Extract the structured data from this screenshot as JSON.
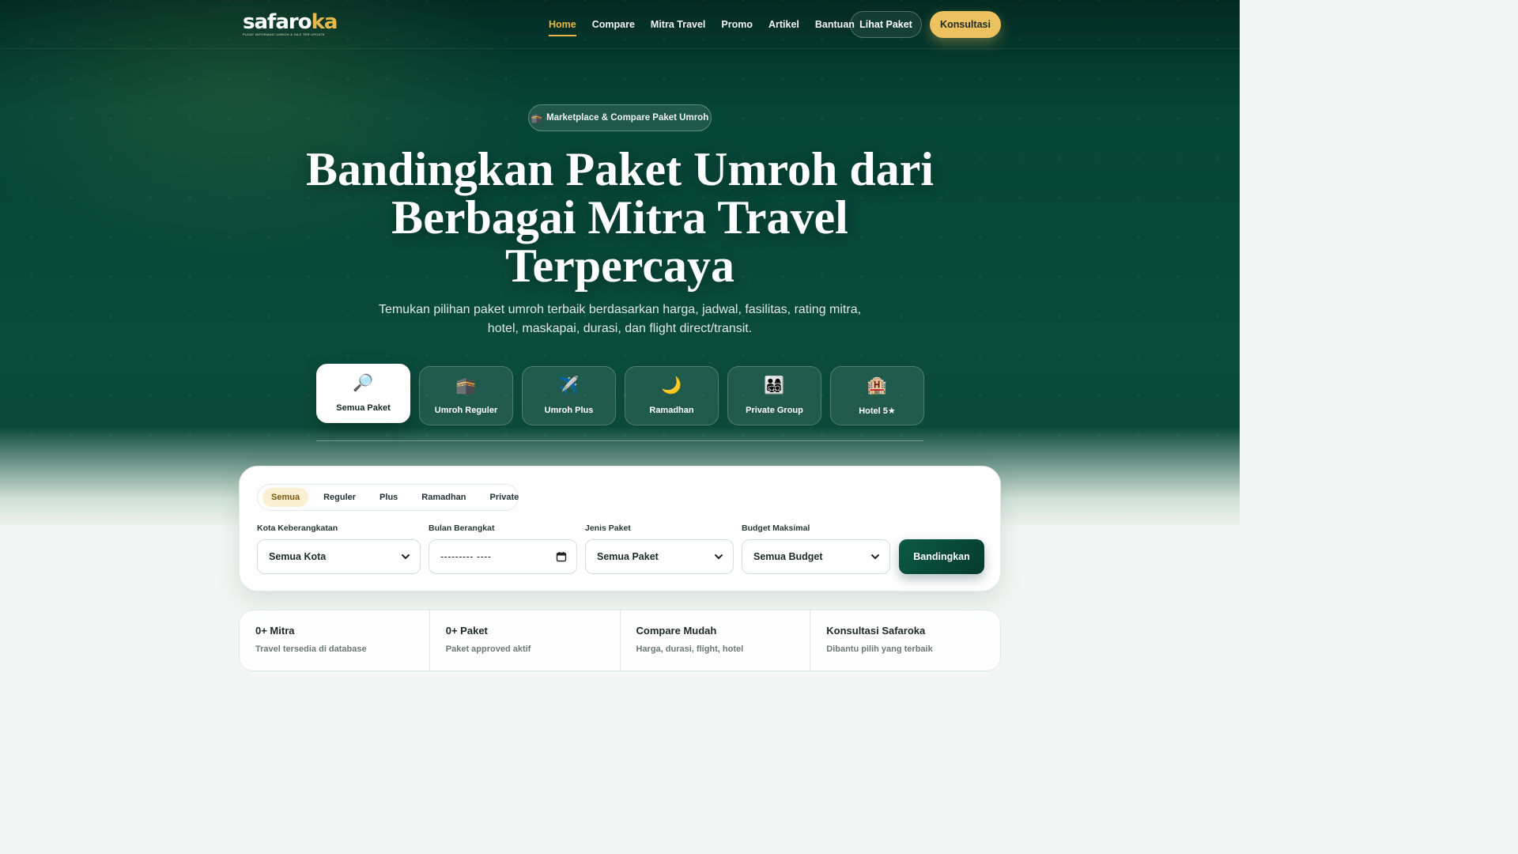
{
  "brand": {
    "name_main": "safaro",
    "name_accent": "ka",
    "tagline": "PUSAT INFORMASI UMROH & HAJI TER UPDATE"
  },
  "nav": {
    "items": [
      {
        "label": "Home",
        "active": true
      },
      {
        "label": "Compare"
      },
      {
        "label": "Mitra Travel"
      },
      {
        "label": "Promo"
      },
      {
        "label": "Artikel"
      },
      {
        "label": "Bantuan"
      }
    ],
    "lihat_paket": "Lihat Paket",
    "konsultasi": "Konsultasi"
  },
  "hero": {
    "badge_icon": "🕋",
    "badge": "Marketplace & Compare Paket Umroh",
    "title": "Bandingkan Paket Umroh dari Berbagai Mitra Travel Terpercaya",
    "subtitle": "Temukan pilihan paket umroh terbaik berdasarkan harga, jadwal, fasilitas, rating mitra, hotel, maskapai, durasi, dan flight direct/transit."
  },
  "categories": [
    {
      "icon": "🔎",
      "label": "Semua Paket",
      "active": true
    },
    {
      "icon": "🕋",
      "label": "Umroh Reguler"
    },
    {
      "icon": "✈️",
      "label": "Umroh Plus"
    },
    {
      "icon": "🌙",
      "label": "Ramadhan"
    },
    {
      "icon": "👨‍👩‍👧‍👦",
      "label": "Private Group"
    },
    {
      "icon": "🏨",
      "label": "Hotel 5★"
    }
  ],
  "search": {
    "tabs": [
      "Semua",
      "Reguler",
      "Plus",
      "Ramadhan",
      "Private"
    ],
    "active_tab": "Semua",
    "fields": {
      "kota_label": "Kota Keberangkatan",
      "kota_value": "Semua Kota",
      "bulan_label": "Bulan Berangkat",
      "bulan_value": "--------- ----",
      "jenis_label": "Jenis Paket",
      "jenis_value": "Semua Paket",
      "budget_label": "Budget Maksimal",
      "budget_value": "Semua Budget"
    },
    "submit": "Bandingkan"
  },
  "stats": [
    {
      "title": "0+ Mitra",
      "desc": "Travel tersedia di database"
    },
    {
      "title": "0+ Paket",
      "desc": "Paket approved aktif"
    },
    {
      "title": "Compare Mudah",
      "desc": "Harga, durasi, flight, hotel"
    },
    {
      "title": "Konsultasi Safaroka",
      "desc": "Dibantu pilih yang terbaik"
    }
  ],
  "colors": {
    "primary": "#064537",
    "accent": "#ecc15f",
    "active_nav": "#e8b84a"
  }
}
